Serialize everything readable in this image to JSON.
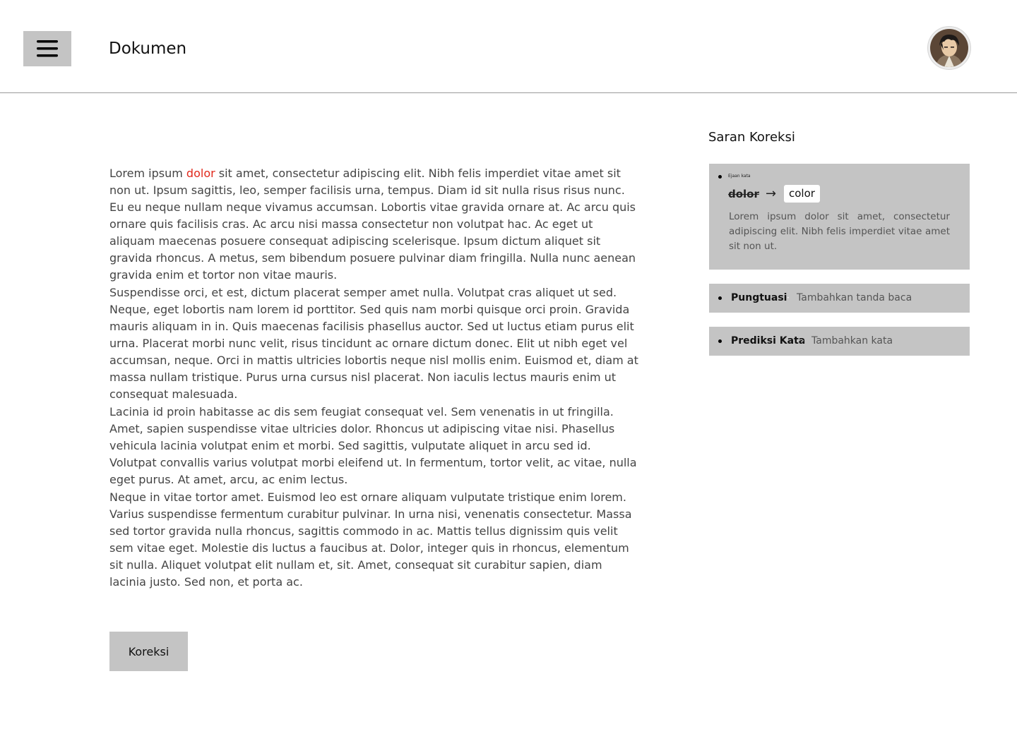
{
  "header": {
    "title": "Dokumen",
    "menu_icon": "hamburger-menu-icon",
    "avatar_icon": "user-avatar"
  },
  "document": {
    "p1_before": "Lorem ipsum ",
    "p1_error": "dolor",
    "p1_after": " sit amet, consectetur adipiscing elit. Nibh felis imperdiet vitae amet sit non ut. Ipsum sagittis, leo, semper facilisis urna, tempus. Diam id sit nulla risus risus nunc. Eu eu neque nullam neque vivamus accumsan. Lobortis vitae gravida ornare at. Ac arcu quis ornare quis facilisis cras. Ac arcu nisi massa consectetur non volutpat hac. Ac eget ut aliquam maecenas posuere consequat adipiscing scelerisque. Ipsum dictum aliquet sit gravida rhoncus. A metus, sem bibendum posuere pulvinar diam fringilla. Nulla nunc aenean gravida enim et tortor non vitae mauris.",
    "p2": "Suspendisse orci, et est, dictum placerat semper amet nulla. Volutpat cras aliquet ut sed. Neque, eget lobortis nam lorem id porttitor. Sed quis nam morbi quisque orci proin. Gravida mauris aliquam in in. Quis maecenas facilisis phasellus auctor. Sed ut luctus etiam purus elit urna. Placerat morbi nunc velit, risus tincidunt ac ornare dictum donec. Elit ut nibh eget vel accumsan, neque. Orci in mattis ultricies lobortis neque nisl mollis enim. Euismod et, diam at massa nullam tristique. Purus urna cursus nisl placerat. Non iaculis lectus mauris enim ut consequat malesuada.",
    "p3": "Lacinia id proin habitasse ac dis sem feugiat consequat vel. Sem venenatis in ut fringilla. Amet, sapien suspendisse vitae ultricies dolor. Rhoncus ut adipiscing vitae nisi. Phasellus vehicula lacinia volutpat enim et morbi. Sed sagittis, vulputate aliquet in arcu sed id. Volutpat convallis varius volutpat morbi eleifend ut. In fermentum, tortor velit, ac vitae, nulla eget purus. At amet, arcu, ac enim lectus.",
    "p4": "Neque in vitae tortor amet. Euismod leo est ornare aliquam vulputate tristique enim lorem. Varius suspendisse fermentum curabitur pulvinar. In urna nisi, venenatis consectetur. Massa sed tortor gravida nulla rhoncus, sagittis commodo in ac. Mattis tellus dignissim quis velit sem vitae eget. Molestie dis luctus a faucibus at. Dolor, integer quis in rhoncus, elementum sit nulla. Aliquet volutpat elit nullam et, sit. Amet, consequat sit curabitur sapien, diam lacinia justo. Sed non, et porta ac.",
    "error_color": "#e0281b"
  },
  "actions": {
    "koreksi_label": "Koreksi"
  },
  "panel": {
    "title": "Saran Koreksi",
    "main_card": {
      "category": "Ejaan kata",
      "wrong": "dolor",
      "arrow": "→",
      "suggestion": "color",
      "preview": "Lorem ipsum dolor sit amet, consectetur adipiscing elit. Nibh felis imperdiet vitae amet sit non ut."
    },
    "cards": [
      {
        "category": "Pungtuasi",
        "separator": "·",
        "description": "Tambahkan tanda baca"
      },
      {
        "category": "Prediksi Kata",
        "separator": "·",
        "description": "Tambahkan kata"
      }
    ]
  }
}
